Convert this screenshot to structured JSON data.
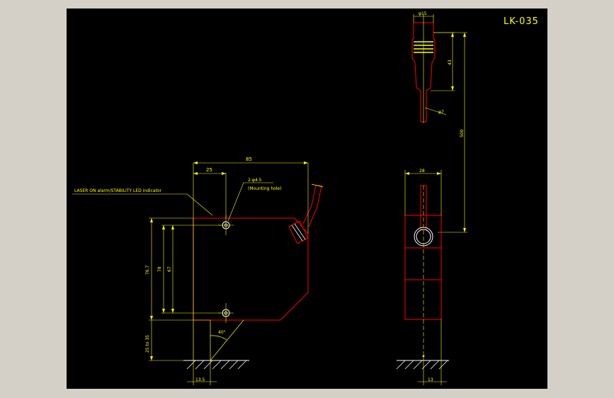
{
  "drawing": {
    "title": "LK-035",
    "colors": {
      "background": "#000000",
      "frame": "#d4d0c8",
      "outline": "#ff0000",
      "dimension": "#ffff00",
      "hatch": "#ffffff"
    }
  },
  "front_view": {
    "led_note": "LASER ON alarm/STABILITY LED indicator",
    "hole_note_line1": "2-φ4.5",
    "hole_note_line2": "(Mounting hole)",
    "dim_width": "85",
    "dim_hole_offset": "25",
    "dim_height": "76.7",
    "dim_hole_spacing": "78",
    "dim_inner": "67",
    "dim_range": "25 to 35",
    "dim_angle": "40°",
    "dim_base": "13.5"
  },
  "side_view": {
    "dim_connector_dia": "φ15",
    "dim_connector_len": "43",
    "dim_cable_dia": "φ7",
    "dim_cable_len": "500",
    "dim_width": "28",
    "dim_base": "13"
  }
}
